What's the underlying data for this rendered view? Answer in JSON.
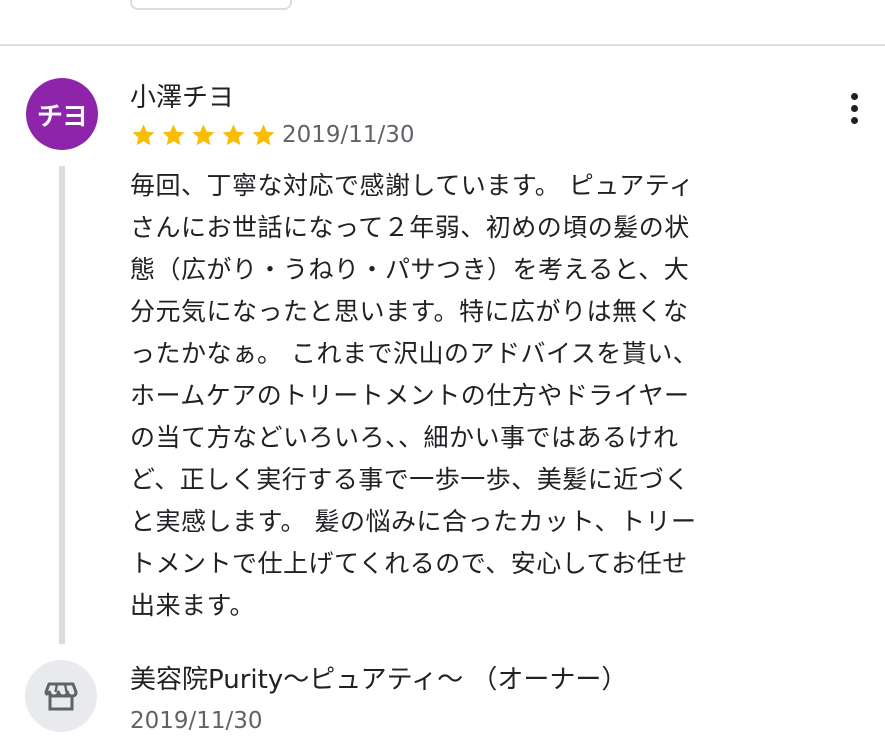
{
  "colors": {
    "avatar_bg": "#8e24aa",
    "star": "#fbbc04",
    "owner_avatar_bg": "#e8eaed",
    "owner_icon": "#5f6368"
  },
  "review": {
    "avatar_initials": "チヨ",
    "reviewer_name": "小澤チヨ",
    "rating": 5,
    "rating_max": 5,
    "date": "2019/11/30",
    "more_icon": "more-vert-icon",
    "text_lines": [
      "毎回、丁寧な対応で感謝しています。 ピュアティ",
      "さんにお世話になって２年弱、初めの頃の髪の状",
      "態（広がり・うねり・パサつき）を考えると、大",
      "分元気になったと思います。特に広がりは無くな",
      "ったかなぁ。 これまで沢山のアドバイスを貰い、",
      "ホームケアのトリートメントの仕方やドライヤー",
      "の当て方などいろいろ、、細かい事ではあるけれ",
      "ど、正しく実行する事で一歩一歩、美髪に近づく",
      "と実感します。 髪の悩みに合ったカット、トリー",
      "トメントで仕上げてくれるので、安心してお任せ",
      "出来ます。"
    ]
  },
  "owner_reply": {
    "icon": "store-icon",
    "name": "美容院Purity〜ピュアティ〜 （オーナー）",
    "date": "2019/11/30"
  }
}
